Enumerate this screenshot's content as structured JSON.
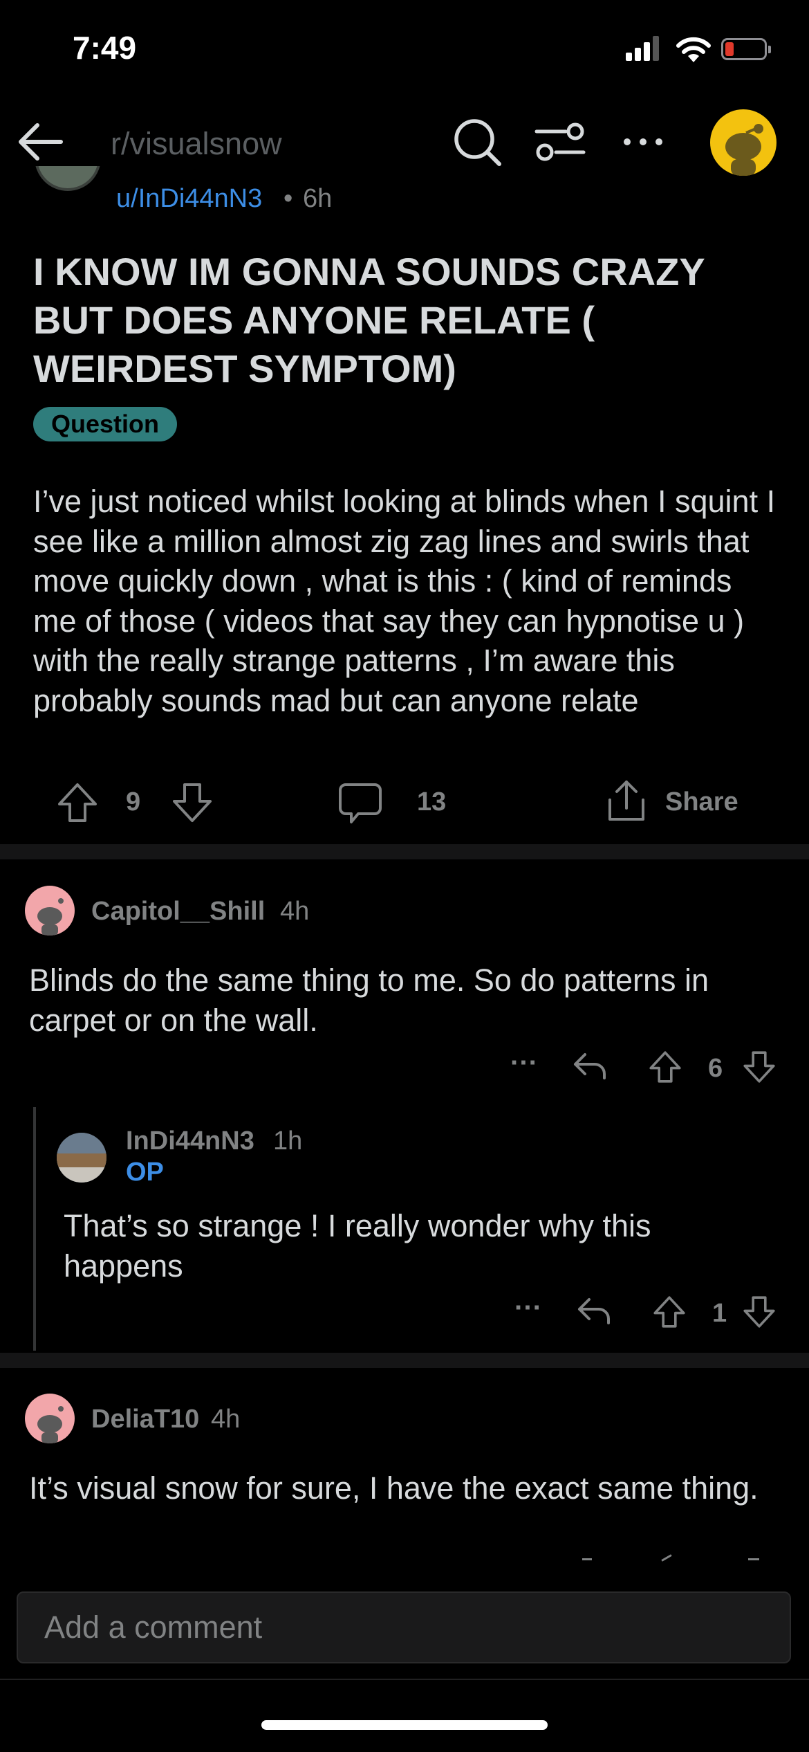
{
  "status_bar": {
    "time": "7:49",
    "battery_color": "#e0392b"
  },
  "header": {
    "subreddit": "r/visualsnow",
    "icons": [
      "back-arrow-icon",
      "search-icon",
      "filter-icon",
      "more-icon",
      "user-avatar"
    ]
  },
  "post": {
    "author": "u/InDi44nN3",
    "separator": "•",
    "time": "6h",
    "title": "I KNOW IM GONNA SOUNDS CRAZY BUT DOES ANYONE RELATE ( WEIRDEST SYMPTOM)",
    "flair": "Question",
    "body": "I’ve just noticed whilst looking at blinds when I squint I see like a million almost zig zag lines and swirls that move quickly down , what is this : ( kind of reminds me of those ( videos that say they can hypnotise u ) with the really strange patterns , I’m aware this probably sounds mad but can anyone relate",
    "score": "9",
    "comments": "13",
    "share": "Share"
  },
  "comments": [
    {
      "author": "Capitol__Shill",
      "time": "4h",
      "body": "Blinds do the same thing to me. So do patterns in carpet or on the wall.",
      "score": "6",
      "more": "···"
    },
    {
      "author": "InDi44nN3",
      "time": "1h",
      "badge": "OP",
      "body": "That’s so strange ! I really wonder why this happens",
      "score": "1",
      "more": "···"
    },
    {
      "author": "DeliaT10",
      "time": "4h",
      "body": "It’s visual snow for sure, I have the exact same thing."
    }
  ],
  "composer": {
    "placeholder": "Add a comment"
  },
  "colors": {
    "accent_blue": "#3d8ee6",
    "flair": "#2f7d7c",
    "avatar_yellow": "#f3c20f",
    "avatar_pink": "#f2a6aa"
  }
}
